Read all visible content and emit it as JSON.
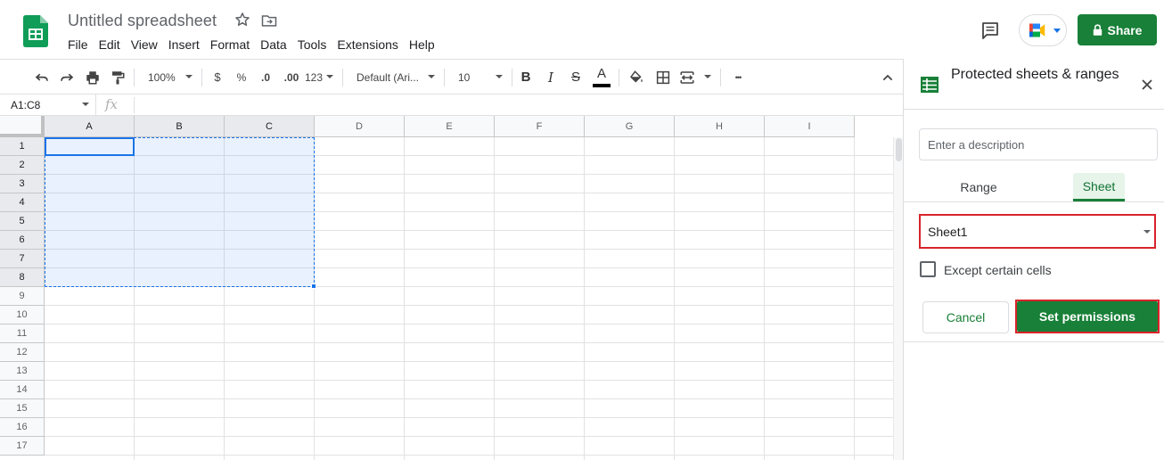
{
  "header": {
    "doc_title": "Untitled spreadsheet",
    "menu": [
      "File",
      "Edit",
      "View",
      "Insert",
      "Format",
      "Data",
      "Tools",
      "Extensions",
      "Help"
    ],
    "share_label": "Share"
  },
  "toolbar": {
    "zoom": "100%",
    "currency": "$",
    "percent": "%",
    "decrease_decimal": ".0",
    "increase_decimal": ".00",
    "more_formats": "123",
    "font": "Default (Ari...",
    "font_size": "10",
    "bold": "B",
    "italic": "I",
    "strike": "S",
    "text_color": "A",
    "more": "•••"
  },
  "formula_bar": {
    "name_box": "A1:C8",
    "fx": "fx"
  },
  "grid": {
    "columns": [
      "A",
      "B",
      "C",
      "D",
      "E",
      "F",
      "G",
      "H",
      "I"
    ],
    "rows": [
      "1",
      "2",
      "3",
      "4",
      "5",
      "6",
      "7",
      "8",
      "9",
      "10",
      "11",
      "12",
      "13",
      "14",
      "15",
      "16",
      "17"
    ]
  },
  "panel": {
    "title": "Protected sheets & ranges",
    "description_placeholder": "Enter a description",
    "tabs": [
      "Range",
      "Sheet"
    ],
    "active_tab": "Sheet",
    "sheet_value": "Sheet1",
    "except_label": "Except certain cells",
    "cancel_label": "Cancel",
    "set_permissions_label": "Set permissions"
  },
  "colors": {
    "brand_green": "#188038",
    "selection_blue": "#1a73e8",
    "highlight_red": "#d8232a"
  }
}
